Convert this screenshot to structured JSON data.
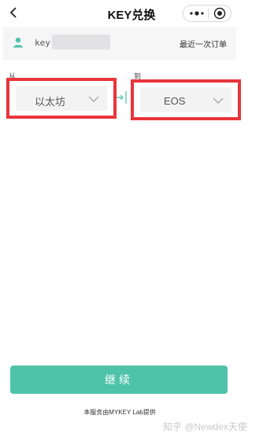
{
  "header": {
    "title": "KEY兑换",
    "back_icon": "chevron-left-icon",
    "more_icon": "more-dots-icon",
    "close_icon": "target-icon"
  },
  "account": {
    "icon": "user-icon",
    "key_prefix": "key",
    "history_link": "最近一次订单"
  },
  "exchange": {
    "from_label": "从",
    "to_label": "到",
    "from_value": "以太坊",
    "to_value": "EOS",
    "highlight_color": "#e8353a"
  },
  "actions": {
    "continue_label": "继续",
    "accent_color": "#4ec3a9"
  },
  "footer": {
    "provider_text": "本服务由MYKEY Lab提供",
    "watermark": "知乎 @Newdex天使"
  }
}
